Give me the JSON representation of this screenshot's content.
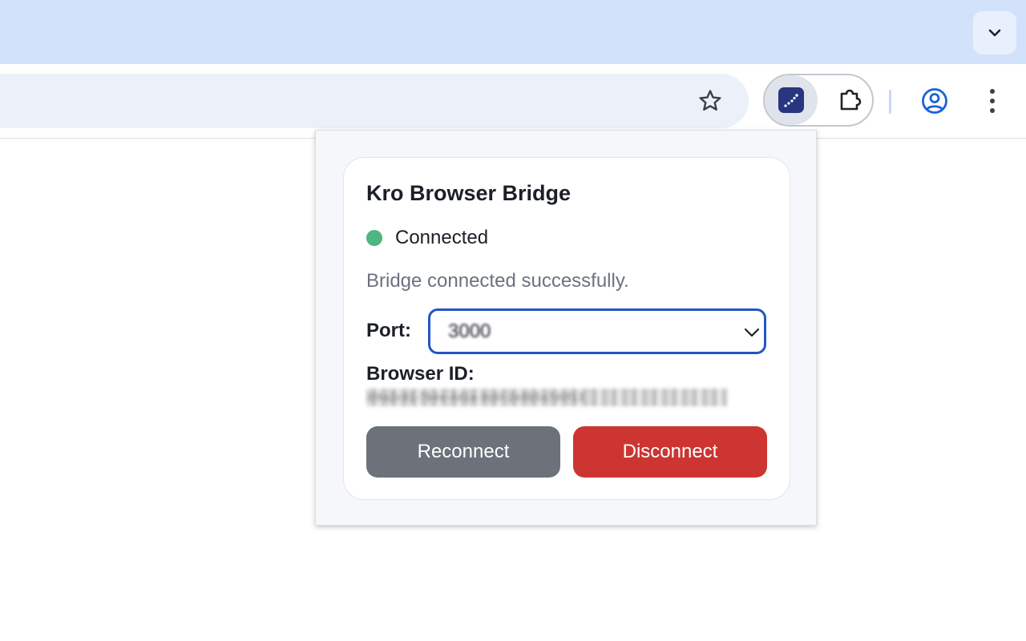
{
  "popup": {
    "title": "Kro Browser Bridge",
    "status": {
      "text": "Connected",
      "color": "#4fb583"
    },
    "message": "Bridge connected successfully.",
    "port": {
      "label": "Port:",
      "value": "3000"
    },
    "browser_id": {
      "label": "Browser ID:",
      "value": "3f8a2c91-7b4e-4d1a-9c6f-2e8b5a7d0f13"
    },
    "buttons": {
      "reconnect": "Reconnect",
      "disconnect": "Disconnect"
    }
  },
  "toolbar": {
    "icons": [
      "tab-search-chevron-icon",
      "bookmark-star-icon",
      "kro-extension-icon",
      "extensions-puzzle-icon",
      "profile-icon",
      "more-menu-icon"
    ]
  },
  "colors": {
    "tabstrip": "#d3e2fb",
    "omnibox": "#ecf0f8",
    "accent_blue": "#2356c4",
    "reconnect": "#6c717a",
    "disconnect": "#cc3531",
    "kro_logo": "#283580"
  }
}
